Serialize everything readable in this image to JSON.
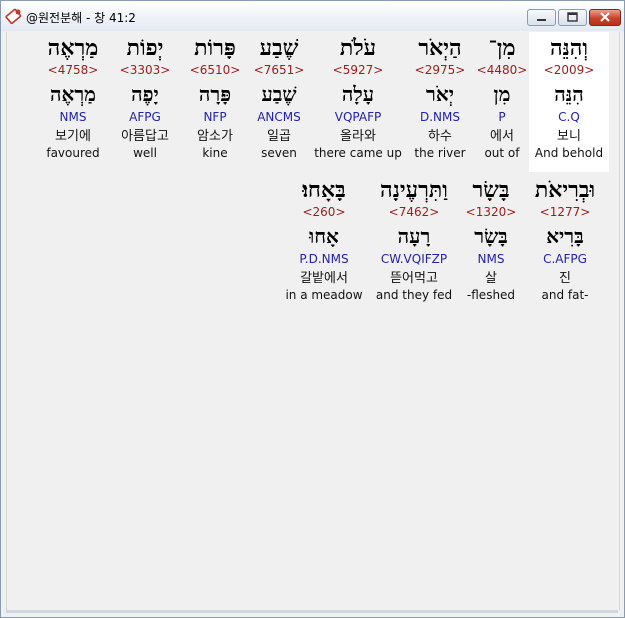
{
  "window": {
    "title": "@원전분해 - 창 41:2"
  },
  "icons": {
    "app": "app-logo-icon",
    "minimize": "minimize-icon",
    "maximize": "maximize-icon",
    "close": "close-icon"
  },
  "colors": {
    "strong_number": "#9b1c1c",
    "morphology": "#2222aa",
    "close_button": "#c6432a"
  },
  "rows": [
    {
      "words": [
        {
          "hebrew": "וְהִנֵּה",
          "strong": "<2009>",
          "lemma": "הִנֵּה",
          "morph": "C.Q",
          "korean": "보니",
          "english": "And behold",
          "selected": true
        },
        {
          "hebrew": "מִן־",
          "strong": "<4480>",
          "lemma": "מִן",
          "morph": "P",
          "korean": "에서",
          "english": "out of"
        },
        {
          "hebrew": "הַיְאֹר",
          "strong": "<2975>",
          "lemma": "יְאֹר",
          "morph": "D.NMS",
          "korean": "하수",
          "english": "the river"
        },
        {
          "hebrew": "עֹלֹת",
          "strong": "<5927>",
          "lemma": "עָלָה",
          "morph": "VQPAFP",
          "korean": "올라와",
          "english": "there came up"
        },
        {
          "hebrew": "שֶׁבַע",
          "strong": "<7651>",
          "lemma": "שֶׁבַע",
          "morph": "ANCMS",
          "korean": "일곱",
          "english": "seven"
        },
        {
          "hebrew": "פָּרוֹת",
          "strong": "<6510>",
          "lemma": "פָּרָה",
          "morph": "NFP",
          "korean": "암소가",
          "english": "kine"
        },
        {
          "hebrew": "יְפוֹת",
          "strong": "<3303>",
          "lemma": "יָפֶה",
          "morph": "AFPG",
          "korean": "아름답고",
          "english": "well"
        },
        {
          "hebrew": "מַרְאֶה",
          "strong": "<4758>",
          "lemma": "מַרְאֶה",
          "morph": "NMS",
          "korean": "보기에",
          "english": "favoured"
        }
      ]
    },
    {
      "words": [
        {
          "hebrew": "וּבְרִיאֹת",
          "strong": "<1277>",
          "lemma": "בָּרִיא",
          "morph": "C.AFPG",
          "korean": "진",
          "english": "and fat-"
        },
        {
          "hebrew": "בָּשָׂר",
          "strong": "<1320>",
          "lemma": "בָּשָׂר",
          "morph": "NMS",
          "korean": "살",
          "english": "-fleshed"
        },
        {
          "hebrew": "וַתִּרְעֶינָה",
          "strong": "<7462>",
          "lemma": "רָעָה",
          "morph": "CW.VQIFZP",
          "korean": "뜯어먹고",
          "english": "and they fed"
        },
        {
          "hebrew": "בָּאָחוּ׃",
          "strong": "<260>",
          "lemma": "אָחוּ",
          "morph": "P.D.NMS",
          "korean": "갈밭에서",
          "english": "in a meadow"
        }
      ]
    }
  ]
}
